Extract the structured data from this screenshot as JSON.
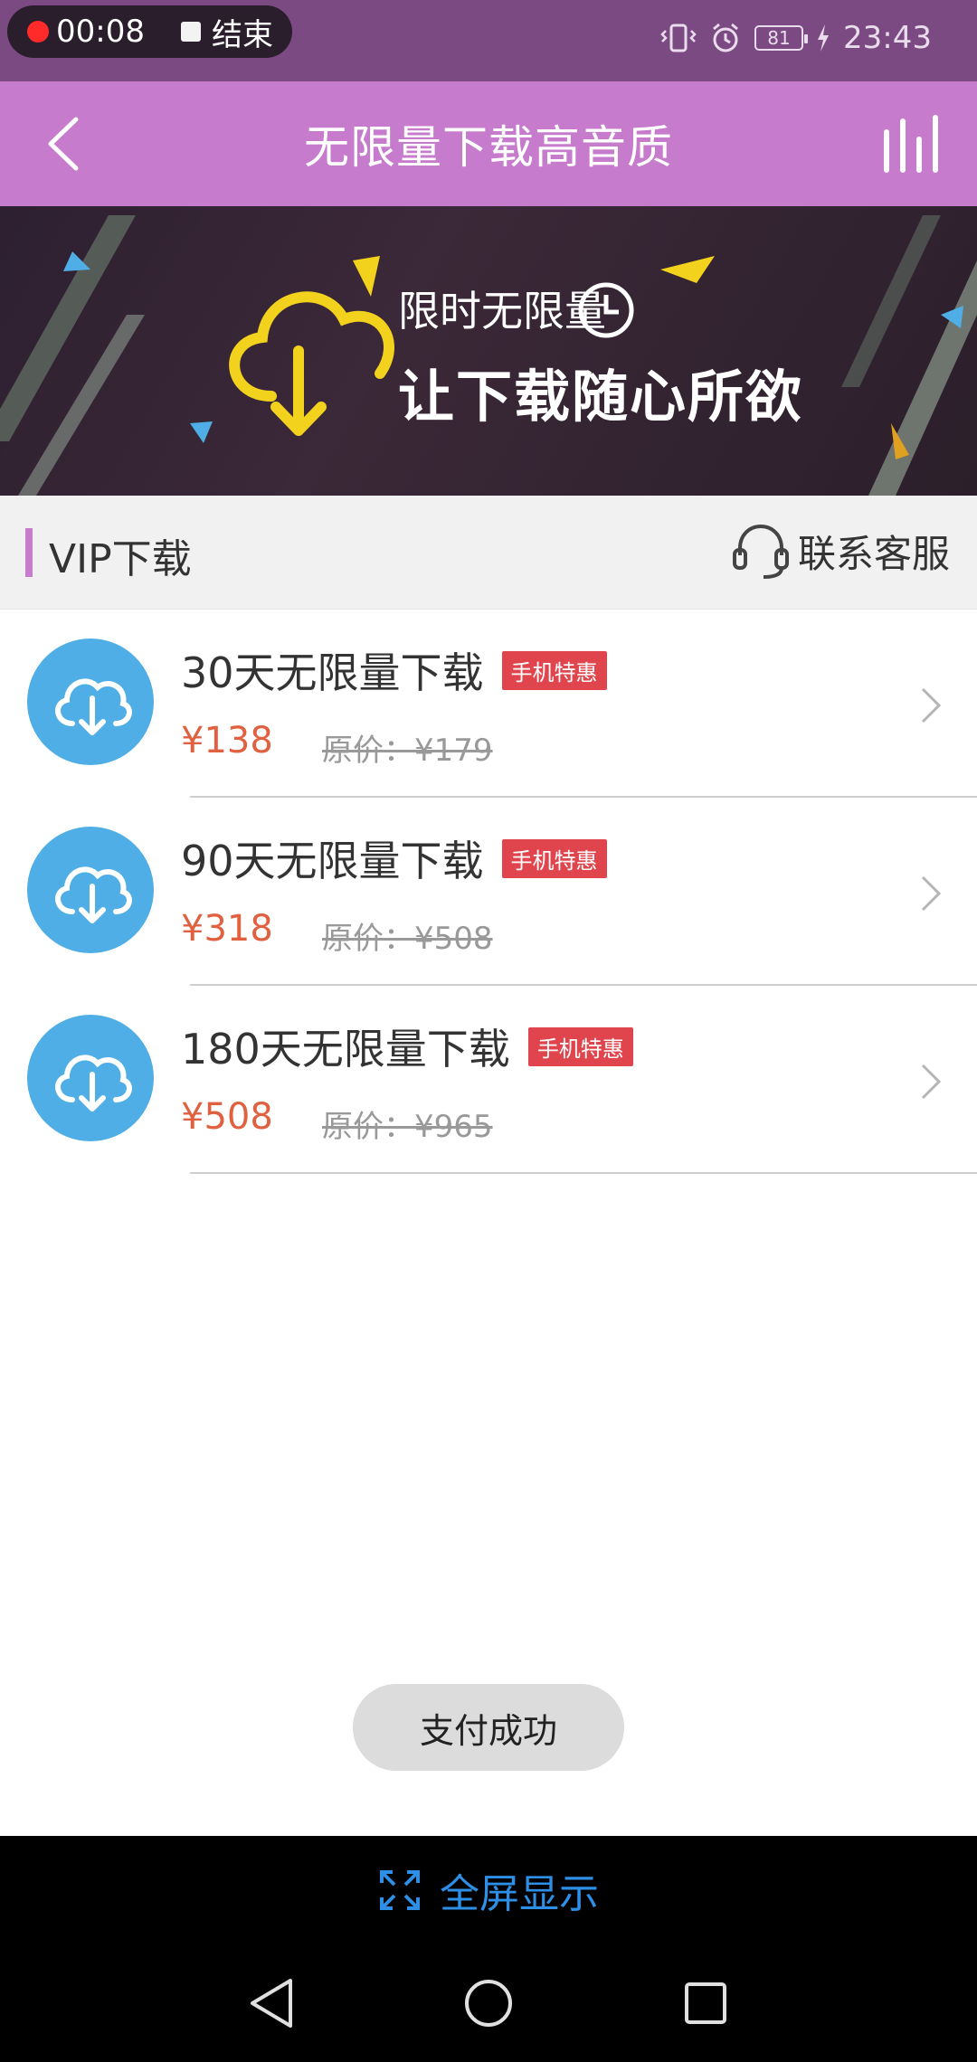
{
  "status_bar": {
    "record_time": "00:08",
    "stop_label": "结束",
    "battery": "81",
    "clock": "23:43"
  },
  "header": {
    "title": "无限量下载高音质"
  },
  "banner": {
    "line1": "限时无限量",
    "line2": "让下载随心所欲"
  },
  "section": {
    "title": "VIP下载",
    "service_label": "联系客服"
  },
  "items": [
    {
      "title": "30天无限量下载",
      "tag": "手机特惠",
      "price": "¥138",
      "original_price": "原价：¥179"
    },
    {
      "title": "90天无限量下载",
      "tag": "手机特惠",
      "price": "¥318",
      "original_price": "原价：¥508"
    },
    {
      "title": "180天无限量下载",
      "tag": "手机特惠",
      "price": "¥508",
      "original_price": "原价：¥965"
    }
  ],
  "toast": {
    "message": "支付成功"
  },
  "fullscreen": {
    "label": "全屏显示"
  },
  "colors": {
    "header": "#c67bcc",
    "status_bar": "#7b4a82",
    "icon_blue": "#4faee5",
    "price": "#e0603f",
    "tag": "#e0454d",
    "fullscreen_text": "#2d8fe6"
  }
}
